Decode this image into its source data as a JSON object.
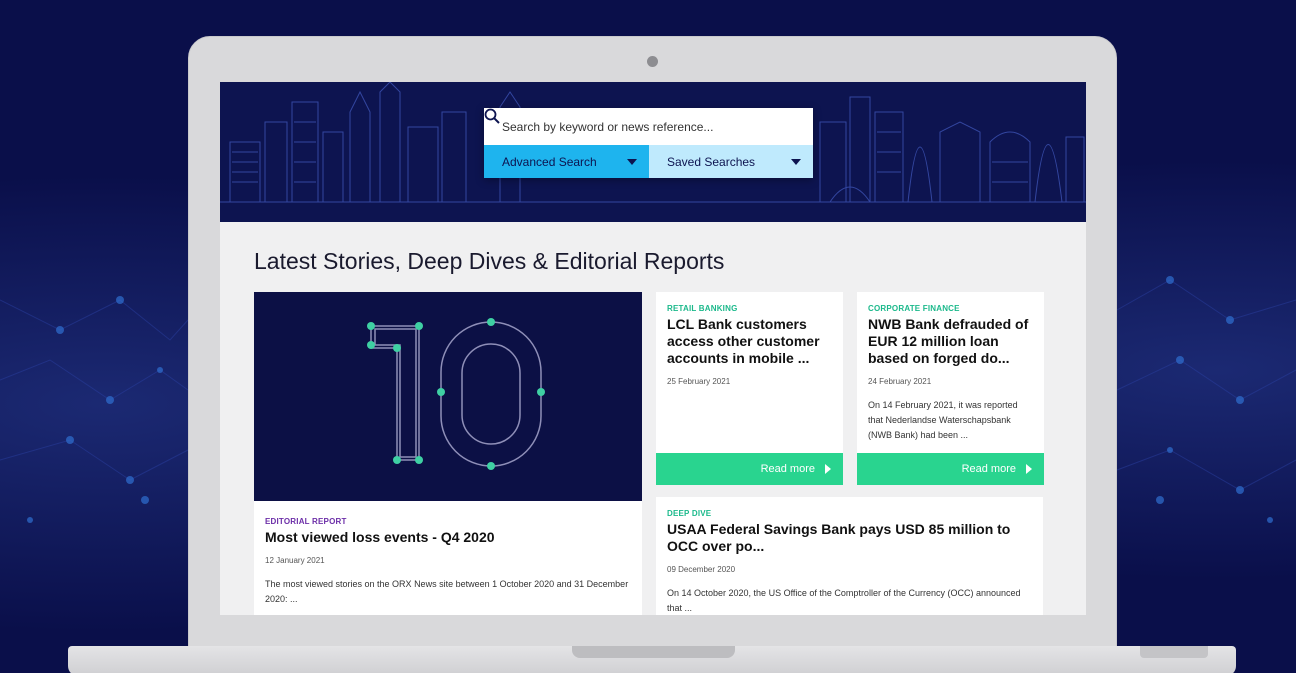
{
  "search": {
    "placeholder": "Search by keyword or news reference...",
    "advanced_label": "Advanced Search",
    "saved_label": "Saved Searches"
  },
  "section_title": "Latest Stories, Deep Dives & Editorial Reports",
  "feature": {
    "image_number": "10",
    "category": "EDITORIAL REPORT",
    "title": "Most viewed loss events - Q4 2020",
    "date": "12 January 2021",
    "summary": "The most viewed stories on the ORX News site between 1 October 2020 and 31 December 2020: ..."
  },
  "cards": [
    {
      "category": "RETAIL BANKING",
      "title": "LCL Bank customers access other customer accounts in mobile ...",
      "date": "25 February 2021",
      "summary": "",
      "cta": "Read more"
    },
    {
      "category": "CORPORATE FINANCE",
      "title": "NWB Bank defrauded of EUR 12 million loan based on forged do...",
      "date": "24 February 2021",
      "summary": "On 14 February 2021, it was reported that Nederlandse Waterschapsbank (NWB Bank) had been ...",
      "cta": "Read more"
    }
  ],
  "wide_card": {
    "category": "DEEP DIVE",
    "title": "USAA Federal Savings Bank pays USD 85 million to OCC over po...",
    "date": "09 December 2020",
    "summary": "On 14 October 2020, the US Office of the Comptroller of the Currency (OCC) announced that ..."
  },
  "colors": {
    "accent_blue": "#1eb4ee",
    "light_blue": "#bfeafd",
    "read_more_green": "#29d48f",
    "navy": "#0d1450"
  }
}
